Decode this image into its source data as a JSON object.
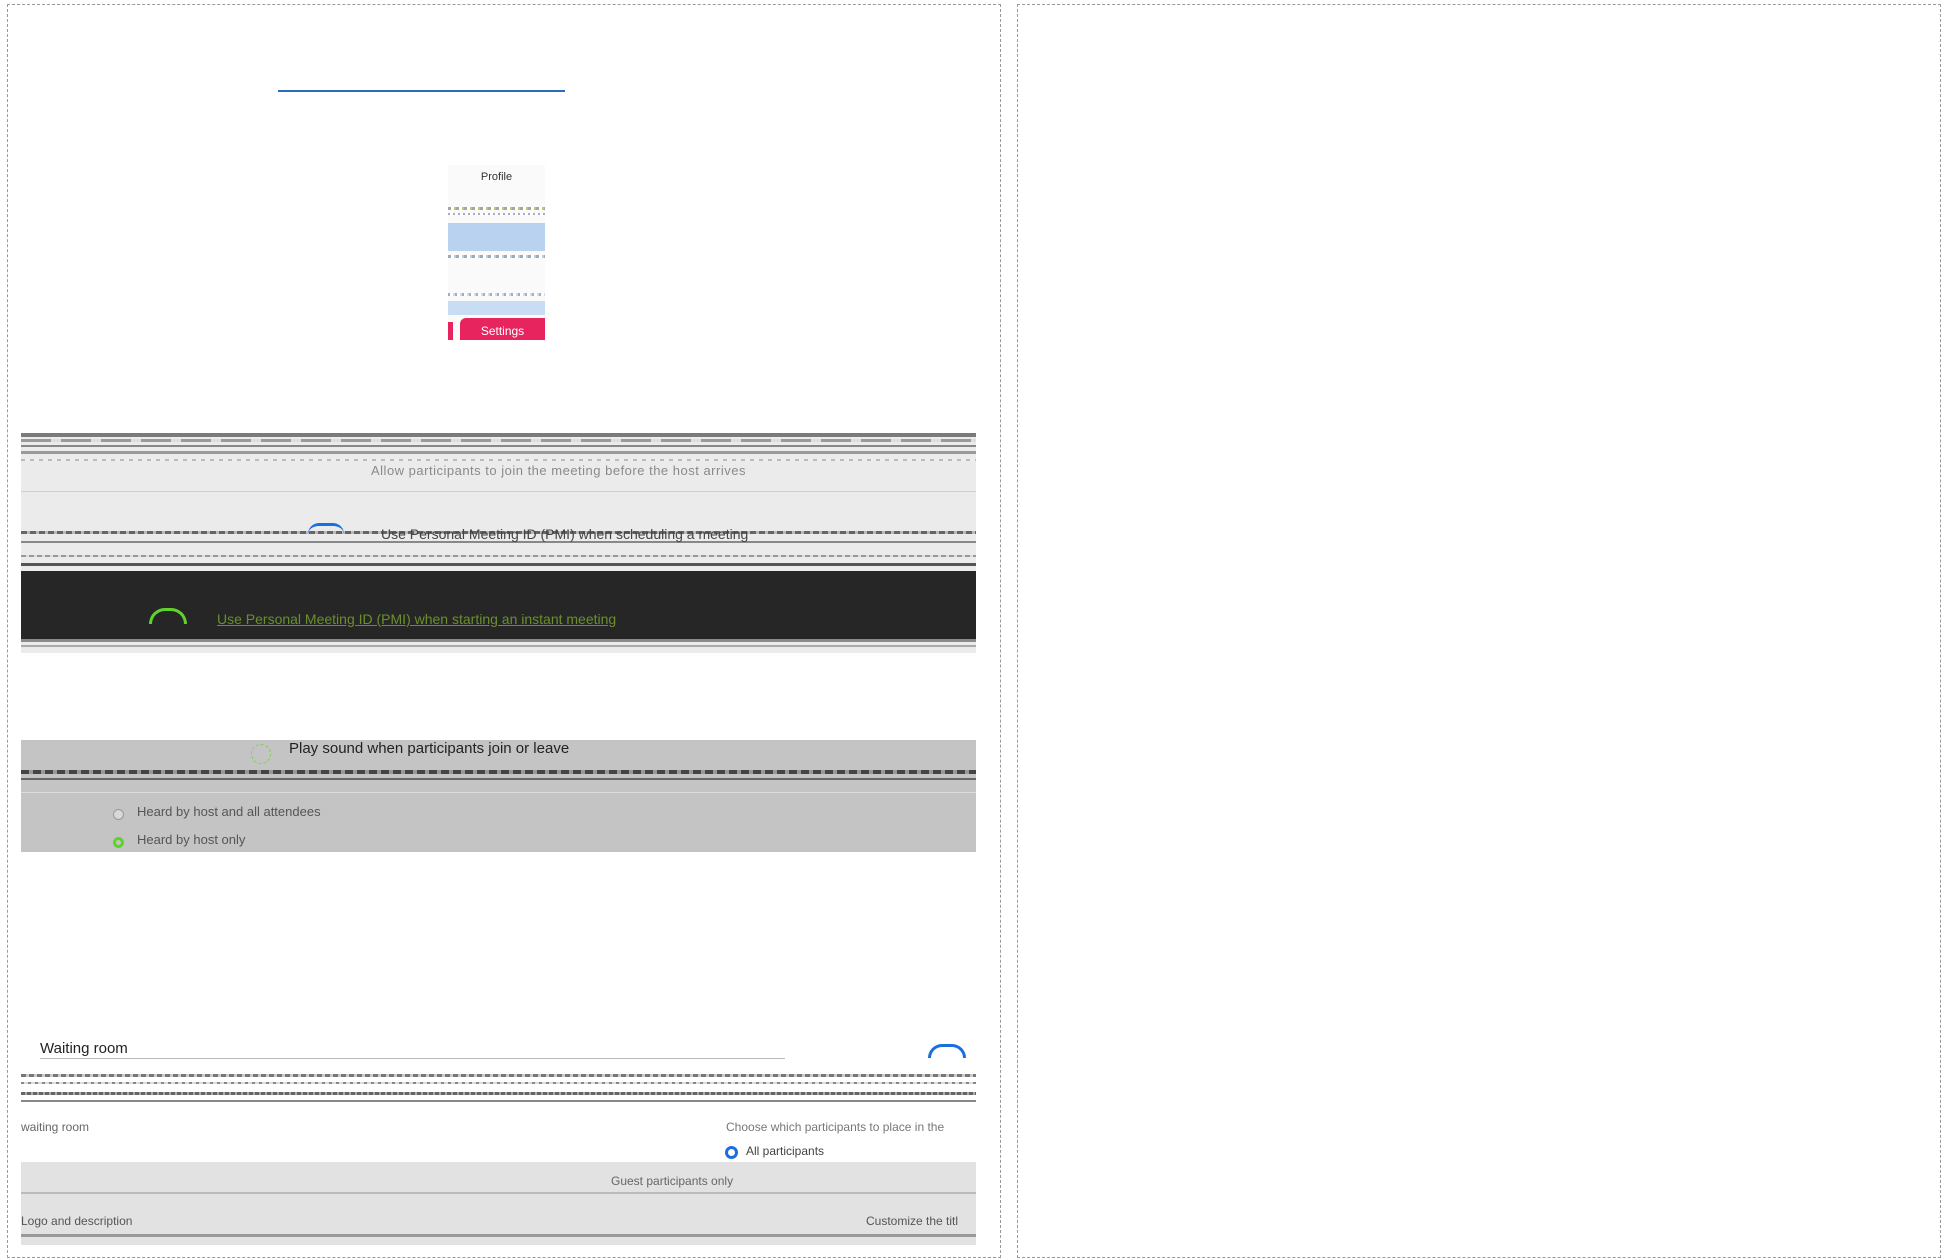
{
  "profile_menu": {
    "profile_label": "Profile",
    "settings_label": "Settings"
  },
  "meeting": {
    "join_before_host_caption": "Allow participants to join the meeting before the host arrives",
    "pmi_label": "Use Personal Meeting ID (PMI) when scheduling a meeting",
    "pmi_instant_label": "Use Personal Meeting ID (PMI) when starting an instant meeting"
  },
  "sound": {
    "title": "Play sound when participants join or leave",
    "options": [
      "Heard by host and all attendees",
      "Heard by host only"
    ],
    "selected": "Heard by host only"
  },
  "waiting_room": {
    "title": "Waiting room",
    "row_label": "waiting room",
    "choose_label": "Choose which participants to place in the",
    "option_all": "All participants",
    "option_guest": "Guest participants only",
    "logo_label": "Logo and description",
    "customize_label": "Customize the titl"
  },
  "colors": {
    "accent": "#1a6fe0",
    "settings_pink": "#e8245f",
    "success": "#5fd32b"
  }
}
